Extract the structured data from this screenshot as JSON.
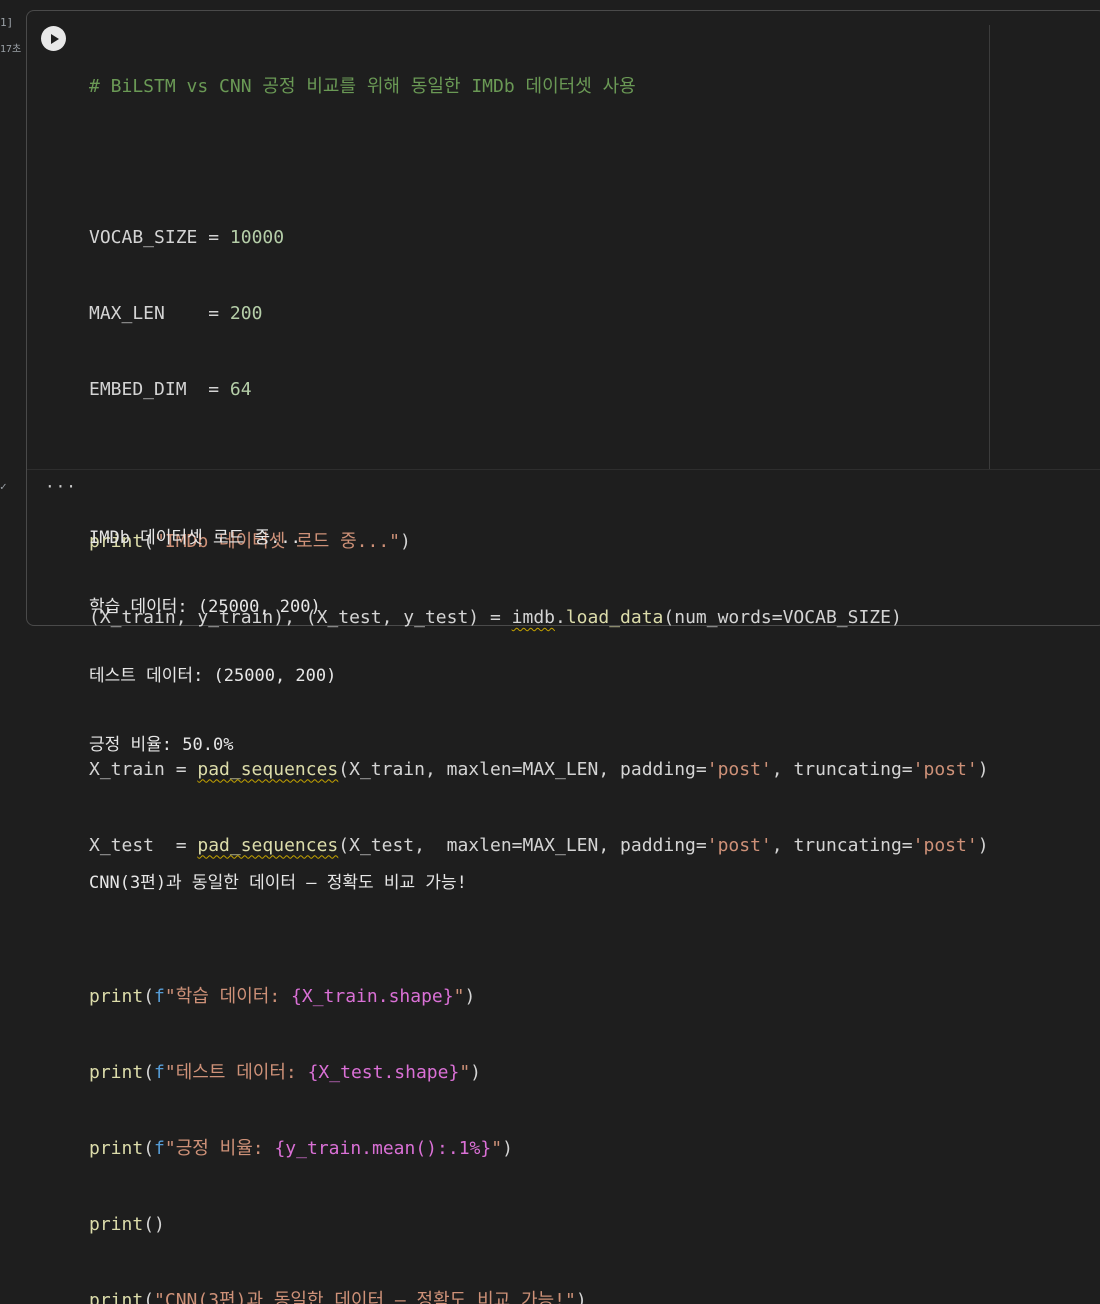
{
  "gutter": {
    "exec_count": "1]",
    "elapsed": "17초",
    "collapse_icon": "chevron-icon"
  },
  "cell": {
    "run_icon": "play-icon",
    "code_lines": [
      "# BiLSTM vs CNN 공정 비교를 위해 동일한 IMDb 데이터셋 사용",
      "",
      "VOCAB_SIZE = 10000",
      "MAX_LEN    = 200",
      "EMBED_DIM  = 64",
      "",
      "print(\"IMDb 데이터셋 로드 중...\")",
      "(X_train, y_train), (X_test, y_test) = imdb.load_data(num_words=VOCAB_SIZE)",
      "",
      "X_train = pad_sequences(X_train, maxlen=MAX_LEN, padding='post', truncating='post')",
      "X_test  = pad_sequences(X_test,  maxlen=MAX_LEN, padding='post', truncating='post')",
      "",
      "print(f\"학습 데이터: {X_train.shape}\")",
      "print(f\"테스트 데이터: {X_test.shape}\")",
      "print(f\"긍정 비율: {y_train.mean():.1%}\")",
      "print()",
      "print(\"CNN(3편)과 동일한 데이터 — 정확도 비교 가능!\")"
    ],
    "output_menu": "···",
    "output_lines": [
      "IMDb 데이터셋 로드 중...",
      "학습 데이터: (25000, 200)",
      "테스트 데이터: (25000, 200)",
      "긍정 비율: 50.0%",
      "",
      "CNN(3편)과 동일한 데이터 — 정확도 비교 가능!"
    ]
  },
  "colors": {
    "background": "#1e1e1e",
    "comment": "#6a9955",
    "function": "#dcdcaa",
    "string": "#ce9178",
    "number": "#b5cea8"
  }
}
